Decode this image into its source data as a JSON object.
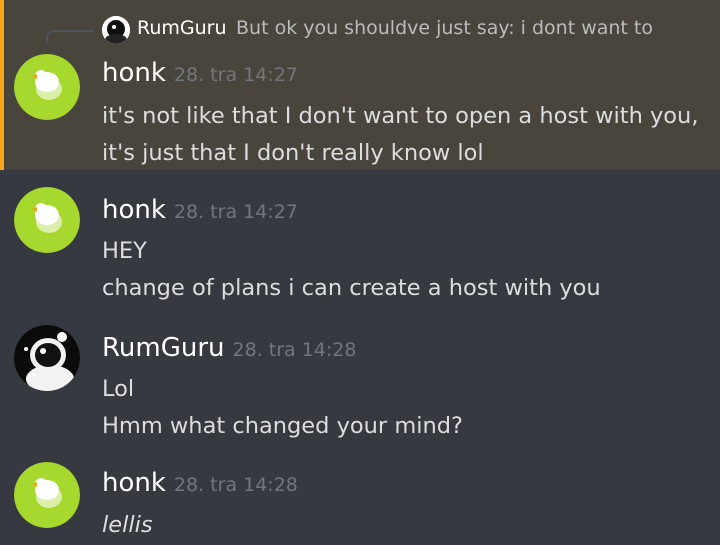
{
  "messages": [
    {
      "reply": {
        "username": "RumGuru",
        "avatar_icon": "astronaut-avatar-icon",
        "text": "But ok you shouldve just say: i dont want to"
      },
      "username": "honk",
      "avatar_icon": "goose-avatar-icon",
      "timestamp": "28. tra 14:27",
      "lines": [
        "it's not like that I don't want to open a host with you,",
        "it's just that I don't really know lol"
      ],
      "highlighted": true
    },
    {
      "username": "honk",
      "avatar_icon": "goose-avatar-icon",
      "timestamp": "28. tra 14:27",
      "lines": [
        "HEY",
        "change of plans i can create a host with you"
      ]
    },
    {
      "username": "RumGuru",
      "avatar_icon": "astronaut-avatar-icon",
      "timestamp": "28. tra 14:28",
      "lines": [
        "Lol",
        "Hmm what changed your mind?"
      ]
    },
    {
      "username": "honk",
      "avatar_icon": "goose-avatar-icon",
      "timestamp": "28. tra 14:28",
      "lines": [
        "lellis"
      ]
    }
  ],
  "colors": {
    "background": "#36393f",
    "highlight_background": "#49443c",
    "highlight_bar": "#faa61a",
    "username": "#ffffff",
    "timestamp": "#72767d",
    "message_text": "#dcddde",
    "goose_avatar_bg": "#a6d82d"
  }
}
